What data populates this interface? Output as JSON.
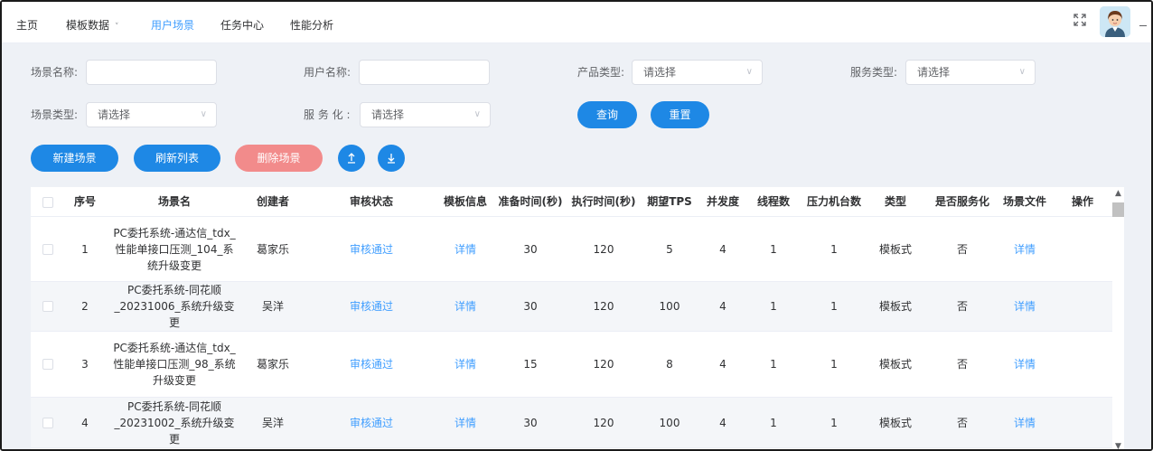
{
  "nav": {
    "items": [
      {
        "label": "主页",
        "active": false
      },
      {
        "label": "模板数据",
        "active": false,
        "has_dropdown": true
      },
      {
        "label": "用户场景",
        "active": true
      },
      {
        "label": "任务中心",
        "active": false
      },
      {
        "label": "性能分析",
        "active": false
      }
    ],
    "chevron": "˅",
    "fullscreen_icon": "fullscreen-icon",
    "avatar_icon": "user-avatar"
  },
  "filters": {
    "scene_name_label": "场景名称:",
    "scene_name_value": "",
    "user_name_label": "用户名称:",
    "user_name_value": "",
    "product_type_label": "产品类型:",
    "product_type_value": "请选择",
    "service_type_label": "服务类型:",
    "service_type_value": "请选择",
    "scene_type_label": "场景类型:",
    "scene_type_value": "请选择",
    "servicized_label": "服 务 化 :",
    "servicized_value": "请选择",
    "select_chevron": "∨"
  },
  "actions": {
    "query": "查询",
    "reset": "重置",
    "new_scene": "新建场景",
    "refresh_list": "刷新列表",
    "delete_scene": "删除场景",
    "upload_icon": "upload-icon",
    "download_icon": "download-icon"
  },
  "colors": {
    "primary": "#1e88e5",
    "danger_disabled": "#f28b8b",
    "link": "#409eff",
    "active_nav": "#409eff"
  },
  "table": {
    "headers": [
      "序号",
      "场景名",
      "创建者",
      "审核状态",
      "模板信息",
      "准备时间(秒)",
      "执行时间(秒)",
      "期望TPS",
      "并发度",
      "线程数",
      "压力机台数",
      "类型",
      "是否服务化",
      "场景文件",
      "操作"
    ],
    "rows": [
      {
        "index": "1",
        "name": "PC委托系统-通达信_tdx_性能单接口压测_104_系统升级变更",
        "creator": "葛家乐",
        "audit": "审核通过",
        "template": "详情",
        "prep": "30",
        "exec": "120",
        "tps": "5",
        "concurrency": "4",
        "threads": "1",
        "machines": "1",
        "type": "模板式",
        "servicized": "否",
        "file": "详情",
        "op": ""
      },
      {
        "index": "2",
        "name": "PC委托系统-同花顺_20231006_系统升级变更",
        "creator": "吴洋",
        "audit": "审核通过",
        "template": "详情",
        "prep": "30",
        "exec": "120",
        "tps": "100",
        "concurrency": "4",
        "threads": "1",
        "machines": "1",
        "type": "模板式",
        "servicized": "否",
        "file": "详情",
        "op": ""
      },
      {
        "index": "3",
        "name": "PC委托系统-通达信_tdx_性能单接口压测_98_系统升级变更",
        "creator": "葛家乐",
        "audit": "审核通过",
        "template": "详情",
        "prep": "15",
        "exec": "120",
        "tps": "8",
        "concurrency": "4",
        "threads": "1",
        "machines": "1",
        "type": "模板式",
        "servicized": "否",
        "file": "详情",
        "op": ""
      },
      {
        "index": "4",
        "name": "PC委托系统-同花顺_20231002_系统升级变更",
        "creator": "吴洋",
        "audit": "审核通过",
        "template": "详情",
        "prep": "30",
        "exec": "120",
        "tps": "100",
        "concurrency": "4",
        "threads": "1",
        "machines": "1",
        "type": "模板式",
        "servicized": "否",
        "file": "详情",
        "op": ""
      }
    ]
  },
  "scrollbar": {
    "up": "▲",
    "down": "▼"
  }
}
